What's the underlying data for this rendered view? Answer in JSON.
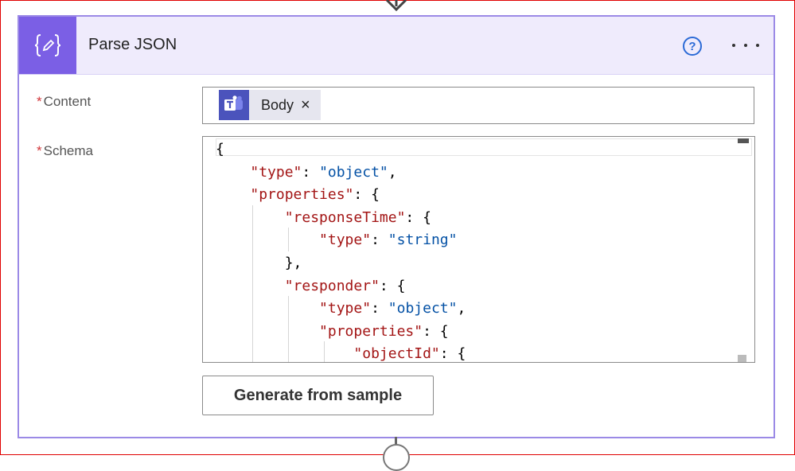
{
  "card": {
    "title": "Parse JSON",
    "help_icon": "question-circle-icon",
    "help_label": "?",
    "more_icon": "ellipsis-icon",
    "action_icon": "curly-braces-edit-icon",
    "accent_color": "#7b5fe5",
    "header_bg": "#efebfc"
  },
  "content_field": {
    "label": "Content",
    "required_marker": "*",
    "token": {
      "label": "Body",
      "icon": "microsoft-teams-icon",
      "remove_label": "×"
    }
  },
  "schema_field": {
    "label": "Schema",
    "required_marker": "*",
    "lines": [
      "{",
      "    \"type\": \"object\",",
      "    \"properties\": {",
      "        \"responseTime\": {",
      "            \"type\": \"string\"",
      "        },",
      "        \"responder\": {",
      "            \"type\": \"object\",",
      "            \"properties\": {",
      "                \"objectId\": {"
    ]
  },
  "generate_button": {
    "label": "Generate from sample"
  }
}
